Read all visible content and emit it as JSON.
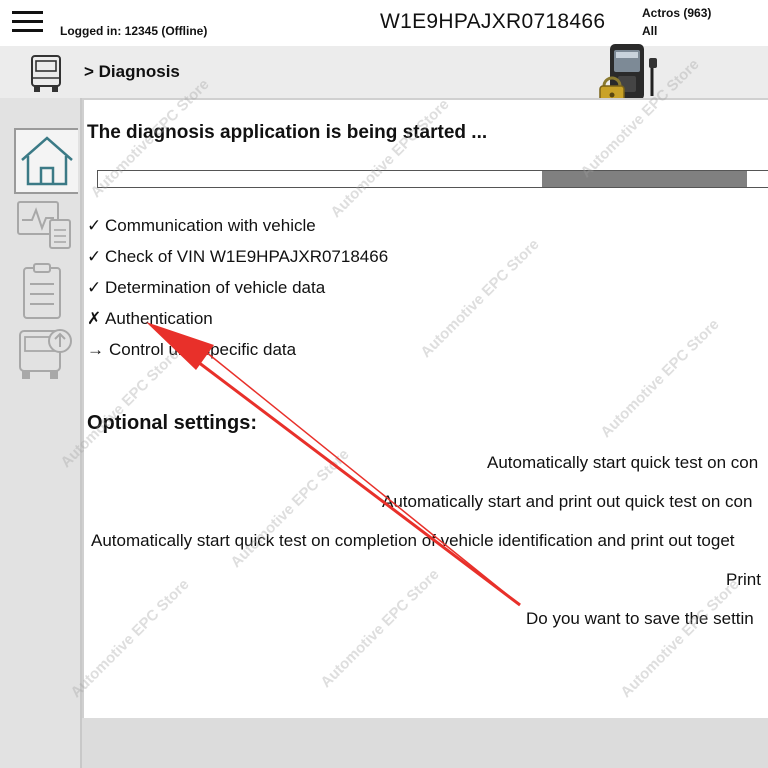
{
  "header": {
    "logged_in": "Logged in: 12345 (Offline)",
    "vin": "W1E9HPAJXR0718466",
    "model_line1": "Actros (963)",
    "model_line2": "All"
  },
  "breadcrumb": "> Diagnosis",
  "sidebar": {
    "items": [
      {
        "name": "home-icon",
        "active": true
      },
      {
        "name": "diagnosis-chart-icon",
        "active": false
      },
      {
        "name": "clipboard-icon",
        "active": false
      },
      {
        "name": "truck-update-icon",
        "active": false
      }
    ]
  },
  "main": {
    "heading": "The diagnosis application is being started ...",
    "progress_fraction": 0.3,
    "steps": [
      {
        "mark": "✓",
        "label": "Communication with vehicle"
      },
      {
        "mark": "✓",
        "label": "Check of VIN W1E9HPAJXR0718466"
      },
      {
        "mark": "✓",
        "label": "Determination of vehicle data"
      },
      {
        "mark": "✗",
        "label": "Authentication"
      },
      {
        "mark": "→",
        "label": "Control unit-specific data"
      }
    ],
    "optional_heading": "Optional settings:",
    "options": [
      "Automatically start quick test on con",
      "Automatically start and print out quick test on con",
      "Automatically start quick test on completion of vehicle identification and print out toget",
      "Print",
      "Do you want to save the settin"
    ]
  },
  "watermark": "Automotive EPC Store",
  "colors": {
    "annotation_arrow": "#e8302a",
    "progress_fill": "#808080"
  }
}
